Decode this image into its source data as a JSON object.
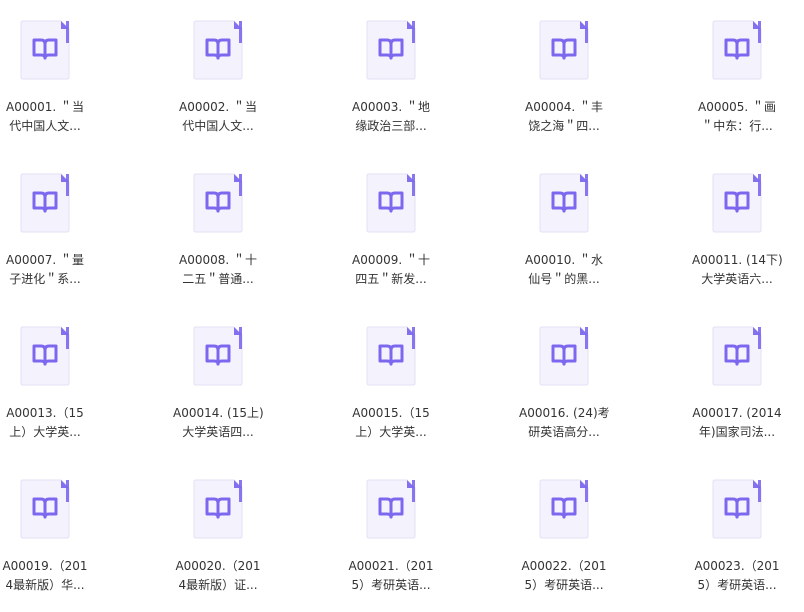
{
  "colors": {
    "icon_fill": "#f4f2fd",
    "icon_border": "#e3e0f5",
    "icon_accent": "#7b68ee",
    "label_text": "#333333"
  },
  "files": [
    {
      "line1": "A00001. ＂当",
      "line2": "代中国人文..."
    },
    {
      "line1": "A00002. ＂当",
      "line2": "代中国人文..."
    },
    {
      "line1": "A00003. ＂地",
      "line2": "缘政治三部..."
    },
    {
      "line1": "A00004. ＂丰",
      "line2": "饶之海＂四..."
    },
    {
      "line1": "A00005. ＂画",
      "line2": "＂中东：行..."
    },
    {
      "line1": "A00007. ＂量",
      "line2": "子进化＂系..."
    },
    {
      "line1": "A00008. ＂十",
      "line2": "二五＂普通..."
    },
    {
      "line1": "A00009. ＂十",
      "line2": "四五＂新发..."
    },
    {
      "line1": "A00010. ＂水",
      "line2": "仙号＂的黑..."
    },
    {
      "line1": "A00011. (14下)",
      "line2": "大学英语六..."
    },
    {
      "line1": "A00013.（15",
      "line2": "上）大学英..."
    },
    {
      "line1": "A00014. (15上)",
      "line2": "大学英语四..."
    },
    {
      "line1": "A00015.（15",
      "line2": "上）大学英..."
    },
    {
      "line1": "A00016. (24)考",
      "line2": "研英语高分..."
    },
    {
      "line1": "A00017. (2014",
      "line2": "年)国家司法..."
    },
    {
      "line1": "A00019.（201",
      "line2": "4最新版）华..."
    },
    {
      "line1": "A00020.（201",
      "line2": "4最新版）证..."
    },
    {
      "line1": "A00021.（201",
      "line2": "5）考研英语..."
    },
    {
      "line1": "A00022.（201",
      "line2": "5）考研英语..."
    },
    {
      "line1": "A00023.（201",
      "line2": "5）考研英语..."
    }
  ],
  "icon_name": "book-file-icon"
}
